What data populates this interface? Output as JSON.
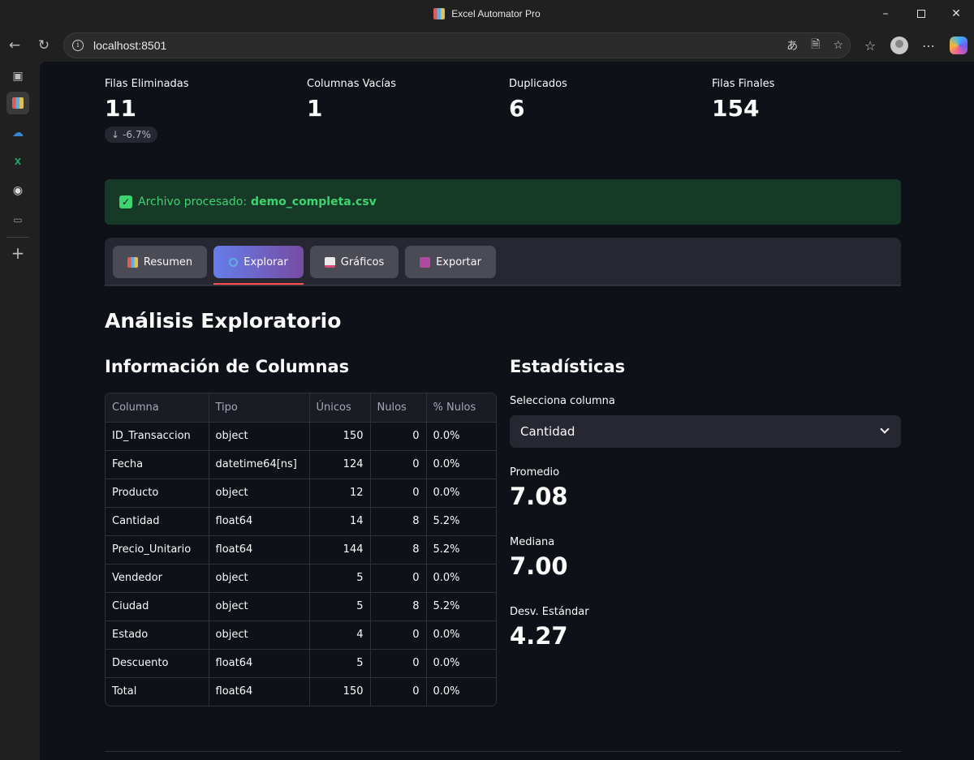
{
  "window": {
    "title": "Excel Automator Pro"
  },
  "browser": {
    "url": "localhost:8501"
  },
  "metrics": [
    {
      "label": "Filas Eliminadas",
      "value": "11",
      "delta": "-6.7%"
    },
    {
      "label": "Columnas Vacías",
      "value": "1"
    },
    {
      "label": "Duplicados",
      "value": "6"
    },
    {
      "label": "Filas Finales",
      "value": "154"
    }
  ],
  "alert": {
    "prefix": "Archivo procesado:",
    "filename": "demo_completa.csv"
  },
  "tabs": [
    {
      "label": "Resumen",
      "icon": "bar-chart-icon"
    },
    {
      "label": "Explorar",
      "icon": "magnifier-icon",
      "active": true
    },
    {
      "label": "Gráficos",
      "icon": "line-chart-icon"
    },
    {
      "label": "Exportar",
      "icon": "floppy-disk-icon"
    }
  ],
  "section_title": "Análisis Exploratorio",
  "columns_info": {
    "title": "Información de Columnas",
    "headers": [
      "Columna",
      "Tipo",
      "Únicos",
      "Nulos",
      "% Nulos"
    ],
    "rows": [
      [
        "ID_Transaccion",
        "object",
        "150",
        "0",
        "0.0%"
      ],
      [
        "Fecha",
        "datetime64[ns]",
        "124",
        "0",
        "0.0%"
      ],
      [
        "Producto",
        "object",
        "12",
        "0",
        "0.0%"
      ],
      [
        "Cantidad",
        "float64",
        "14",
        "8",
        "5.2%"
      ],
      [
        "Precio_Unitario",
        "float64",
        "144",
        "8",
        "5.2%"
      ],
      [
        "Vendedor",
        "object",
        "5",
        "0",
        "0.0%"
      ],
      [
        "Ciudad",
        "object",
        "5",
        "8",
        "5.2%"
      ],
      [
        "Estado",
        "object",
        "4",
        "0",
        "0.0%"
      ],
      [
        "Descuento",
        "float64",
        "5",
        "0",
        "0.0%"
      ],
      [
        "Total",
        "float64",
        "150",
        "0",
        "0.0%"
      ]
    ]
  },
  "stats": {
    "title": "Estadísticas",
    "select_label": "Selecciona columna",
    "selected": "Cantidad",
    "items": [
      {
        "label": "Promedio",
        "value": "7.08"
      },
      {
        "label": "Mediana",
        "value": "7.00"
      },
      {
        "label": "Desv. Estándar",
        "value": "4.27"
      }
    ]
  },
  "colors": {
    "accent_start": "#667eea",
    "accent_end": "#764ba2",
    "success": "#3dd56d",
    "tab_underline": "#ff4b4b"
  }
}
